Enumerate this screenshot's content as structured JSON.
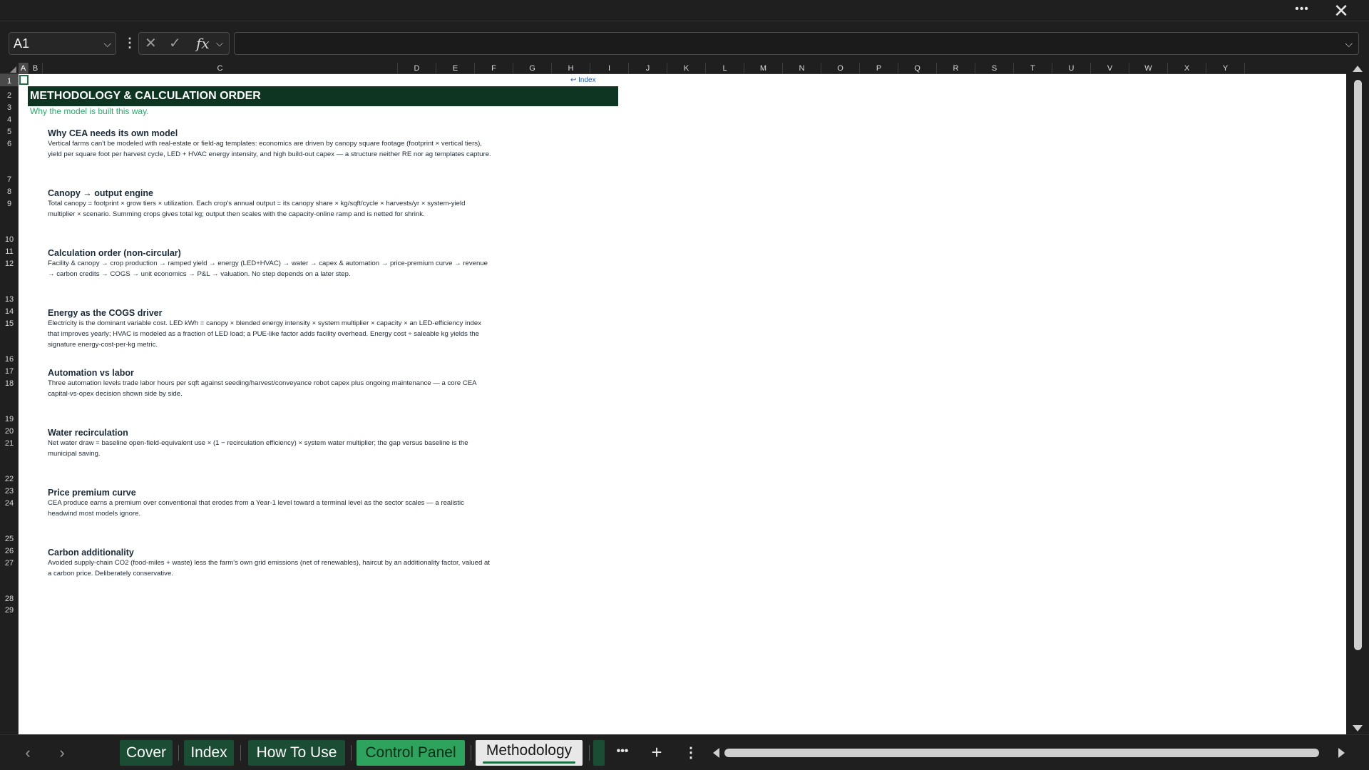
{
  "window": {
    "more_icon": "ellipsis-icon",
    "close_icon": "close-icon"
  },
  "formula_bar": {
    "name_box": "A1",
    "formula": ""
  },
  "columns": [
    "A",
    "B",
    "C",
    "D",
    "E",
    "F",
    "G",
    "H",
    "I",
    "J",
    "K",
    "L",
    "M",
    "N",
    "O",
    "P",
    "Q",
    "R",
    "S",
    "T",
    "U",
    "V",
    "W",
    "X",
    "Y"
  ],
  "rows": [
    "1",
    "2",
    "3",
    "4",
    "5",
    "6",
    "7",
    "8",
    "9",
    "10",
    "11",
    "12",
    "13",
    "14",
    "15",
    "16",
    "17",
    "18",
    "19",
    "20",
    "21",
    "22",
    "23",
    "24",
    "25",
    "26",
    "27",
    "28",
    "29"
  ],
  "sheet": {
    "index_link": "↩ Index",
    "title": "METHODOLOGY & CALCULATION ORDER",
    "subtitle": "Why the model is built this way.",
    "sections": [
      {
        "heading": "Why CEA needs its own model",
        "body": "Vertical farms can't be modeled with real-estate or field-ag templates: economics are driven by canopy square footage (footprint × vertical tiers), yield per square foot per harvest cycle, LED + HVAC energy intensity, and high build-out capex — a structure neither RE nor ag templates capture."
      },
      {
        "heading": "Canopy → output engine",
        "body": "Total canopy = footprint × grow tiers × utilization. Each crop's annual output = its canopy share × kg/sqft/cycle × harvests/yr × system-yield multiplier × scenario. Summing crops gives total kg; output then scales with the capacity-online ramp and is netted for shrink."
      },
      {
        "heading": "Calculation order (non-circular)",
        "body": "Facility & canopy → crop production → ramped yield → energy (LED+HVAC) → water → capex & automation → price-premium curve → revenue → carbon credits → COGS → unit economics → P&L → valuation. No step depends on a later step."
      },
      {
        "heading": "Energy as the COGS driver",
        "body": "Electricity is the dominant variable cost. LED kWh = canopy × blended energy intensity × system multiplier × capacity × an LED-efficiency index that improves yearly; HVAC is modeled as a fraction of LED load; a PUE-like factor adds facility overhead. Energy cost ÷ saleable kg yields the signature energy-cost-per-kg metric."
      },
      {
        "heading": "Automation vs labor",
        "body": "Three automation levels trade labor hours per sqft against seeding/harvest/conveyance robot capex plus ongoing maintenance — a core CEA capital-vs-opex decision shown side by side."
      },
      {
        "heading": "Water recirculation",
        "body": "Net water draw = baseline open-field-equivalent use × (1 − recirculation efficiency) × system water multiplier; the gap versus baseline is the municipal saving."
      },
      {
        "heading": "Price premium curve",
        "body": "CEA produce earns a premium over conventional that erodes from a Year-1 level toward a terminal level as the sector scales — a realistic headwind most models ignore."
      },
      {
        "heading": "Carbon additionality",
        "body": "Avoided supply-chain CO2 (food-miles + waste) less the farm's own grid emissions (net of renewables), haircut by an additionality factor, valued at a carbon price. Deliberately conservative."
      }
    ]
  },
  "tabs": {
    "cover": "Cover",
    "index": "Index",
    "how_to_use": "How To Use",
    "control_panel": "Control Panel",
    "methodology": "Methodology"
  },
  "colors": {
    "title_band": "#0d3522",
    "subtitle": "#2ea86b",
    "tab_dark": "#1a4d33",
    "tab_green": "#2ea35e",
    "active_cell": "#1e7145"
  }
}
